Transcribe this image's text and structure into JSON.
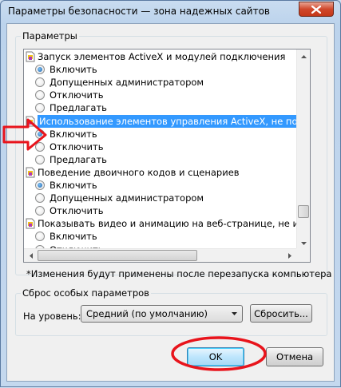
{
  "window": {
    "title": "Параметры безопасности — зона надежных сайтов"
  },
  "settings_group": {
    "label": "Параметры"
  },
  "list": {
    "items": [
      {
        "type": "category",
        "text": "Запуск элементов ActiveX и модулей подключения",
        "selected": false
      },
      {
        "type": "option",
        "text": "Включить",
        "checked": true
      },
      {
        "type": "option",
        "text": "Допущенных администратором",
        "checked": false
      },
      {
        "type": "option",
        "text": "Отключить",
        "checked": false
      },
      {
        "type": "option",
        "text": "Предлагать",
        "checked": false
      },
      {
        "type": "category",
        "text": "Использование элементов управления ActiveX, не помече",
        "selected": true
      },
      {
        "type": "option",
        "text": "Включить",
        "checked": true
      },
      {
        "type": "option",
        "text": "Отключить",
        "checked": false
      },
      {
        "type": "option",
        "text": "Предлагать",
        "checked": false
      },
      {
        "type": "category",
        "text": "Поведение двоичного кодов и сценариев",
        "selected": false
      },
      {
        "type": "option",
        "text": "Включить",
        "checked": true
      },
      {
        "type": "option",
        "text": "Допущенных администратором",
        "checked": false
      },
      {
        "type": "option",
        "text": "Отключить",
        "checked": false
      },
      {
        "type": "category",
        "text": "Показывать видео и анимацию на веб-странице, не испо",
        "selected": false
      },
      {
        "type": "option",
        "text": "Включить",
        "checked": false
      },
      {
        "type": "option",
        "text": "Отключить",
        "checked": false
      }
    ]
  },
  "note": "*Изменения будут применены после перезапуска компьютера",
  "reset_group": {
    "label": "Сброс особых параметров",
    "level_label": "На уровень:",
    "level_value": "Средний (по умолчанию)",
    "reset_button": "Сбросить..."
  },
  "buttons": {
    "ok": "OK",
    "cancel": "Отмена"
  },
  "colors": {
    "annotation": "#e8141c",
    "selection": "#3399ff"
  }
}
